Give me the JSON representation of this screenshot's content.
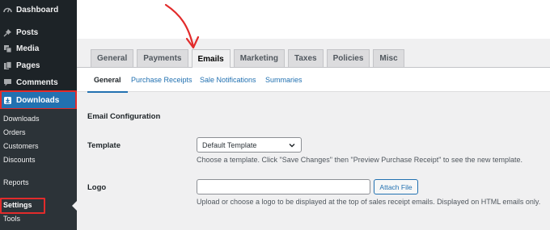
{
  "sidebar": {
    "menu": [
      {
        "label": "Dashboard",
        "icon": "dashboard-icon"
      },
      {
        "label": "Posts",
        "icon": "pushpin-icon"
      },
      {
        "label": "Media",
        "icon": "media-icon"
      },
      {
        "label": "Pages",
        "icon": "pages-icon"
      },
      {
        "label": "Comments",
        "icon": "comments-icon"
      },
      {
        "label": "Downloads",
        "icon": "download-icon"
      }
    ],
    "submenu": [
      "Downloads",
      "Orders",
      "Customers",
      "Discounts",
      "Reports",
      "Settings",
      "Tools"
    ]
  },
  "tabs": [
    "General",
    "Payments",
    "Emails",
    "Marketing",
    "Taxes",
    "Policies",
    "Misc"
  ],
  "subnav": [
    "General",
    "Purchase Receipts",
    "Sale Notifications",
    "Summaries"
  ],
  "content": {
    "section_title": "Email Configuration",
    "template_label": "Template",
    "template_value": "Default Template",
    "template_desc": "Choose a template. Click \"Save Changes\" then \"Preview Purchase Receipt\" to see the new template.",
    "logo_label": "Logo",
    "logo_value": "",
    "attach_button": "Attach File",
    "logo_desc": "Upload or choose a logo to be displayed at the top of sales receipt emails. Displayed on HTML emails only."
  },
  "colors": {
    "accent": "#2271b1",
    "highlight_box": "#e22b2b",
    "sidebar": "#1d2327"
  }
}
